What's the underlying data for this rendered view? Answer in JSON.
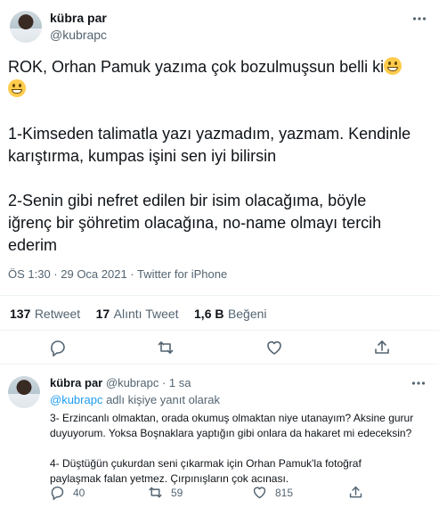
{
  "main_tweet": {
    "author_name": "kübra par",
    "author_handle": "@kubrapc",
    "text_line1": "ROK, Orhan Pamuk yazıma çok bozulmuşsun belli ki",
    "text_p2_l1": "1-Kimseden talimatla yazı yazmadım, yazmam. Kendinle",
    "text_p2_l2": "karıştırma, kumpas işini sen iyi bilirsin",
    "text_p3_l1": "2-Senin gibi nefret edilen bir isim olacağıma, böyle",
    "text_p3_l2": "iğrenç bir şöhretim olacağına, no-name olmayı tercih",
    "text_p3_l3": "ederim",
    "timestamp": "ÖS 1:30 · 29 Oca 2021 · Twitter for iPhone",
    "retweets_count": "137",
    "retweets_label": "Retweet",
    "quotes_count": "17",
    "quotes_label": "Alıntı Tweet",
    "likes_count": "1,6 B",
    "likes_label": "Beğeni"
  },
  "reply": {
    "author_name": "kübra par",
    "author_handle": "@kubrapc",
    "separator": "·",
    "time": "1 sa",
    "reply_to_handle": "@kubrapc",
    "reply_to_suffix": "adlı kişiye yanıt olarak",
    "p1_l1": "3- Erzincanlı olmaktan, orada okumuş olmaktan niye utanayım? Aksine gurur",
    "p1_l2": "duyuyorum. Yoksa Boşnaklara yaptığın gibi onlara da hakaret mi edeceksin?",
    "p2_l1": "4- Düştüğün çukurdan seni çıkarmak için Orhan Pamuk'la fotoğraf",
    "p2_l2": "paylaşmak falan yetmez. Çırpınışların çok acınası.",
    "reply_count": "40",
    "retweet_count": "59",
    "like_count": "815"
  },
  "icons": {
    "more": "more-horizontal-icon",
    "reply": "reply-icon",
    "retweet": "retweet-icon",
    "like": "heart-icon",
    "share": "share-icon",
    "emoji": "grinning-face-emoji"
  },
  "colors": {
    "text": "#0f1419",
    "muted": "#536471",
    "link": "#1d9bf0",
    "divider": "#eff3f4"
  }
}
